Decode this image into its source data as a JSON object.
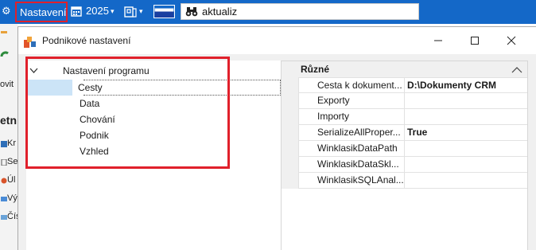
{
  "toolbar": {
    "settings_label": "Nastavení",
    "year": "2025",
    "search_value": "aktualiz"
  },
  "background_app": {
    "rows": [
      {
        "text": "ovit",
        "big": false
      },
      {
        "text": "etn",
        "big": true
      },
      {
        "text": "Kr",
        "big": false
      },
      {
        "text": "Se",
        "big": false
      },
      {
        "text": "Úl",
        "big": false
      },
      {
        "text": "Vý",
        "big": false
      },
      {
        "text": "Čís",
        "big": false
      }
    ]
  },
  "dialog": {
    "title": "Podnikové nastavení",
    "tree": {
      "root_label": "Nastavení programu",
      "children": [
        "Cesty",
        "Data",
        "Chování",
        "Podnik",
        "Vzhled"
      ],
      "selected_index": 0
    },
    "properties": {
      "category": "Různé",
      "rows": [
        {
          "name": "Cesta k dokument...",
          "value": "D:\\Dokumenty CRM"
        },
        {
          "name": "Exporty",
          "value": ""
        },
        {
          "name": "Importy",
          "value": ""
        },
        {
          "name": "SerializeAllProper...",
          "value": "True"
        },
        {
          "name": "WinklasikDataPath",
          "value": ""
        },
        {
          "name": "WinklasikDataSkl...",
          "value": ""
        },
        {
          "name": "WinklasikSQLAnal...",
          "value": ""
        }
      ]
    }
  },
  "colors": {
    "toolbar_bg": "#1468c8",
    "highlight_red": "#e0202b",
    "selection_bg": "#cce4f7"
  }
}
